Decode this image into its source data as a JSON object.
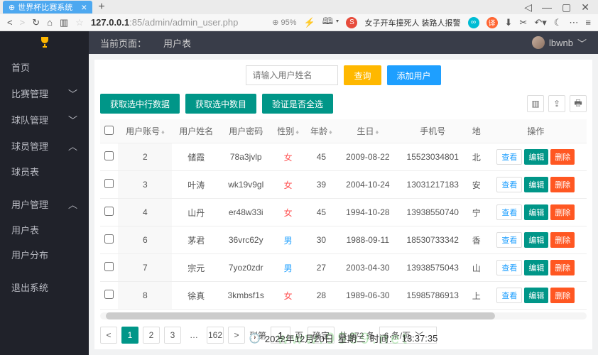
{
  "browser": {
    "tab_title": "世界杯比赛系统",
    "url_prefix": "127.0.0.1",
    "url_rest": ":85/admin/admin_user.php",
    "zoom": "95%",
    "news": "女子开车撞死人 装路人报警",
    "win": {
      "min": "—",
      "max": "▢",
      "close": "✕"
    }
  },
  "topbar": {
    "current_page_label": "当前页面：",
    "current_page": "用户表",
    "username": "lbwnb"
  },
  "sidebar": {
    "home": "首页",
    "match": "比赛管理",
    "team": "球队管理",
    "player": "球员管理",
    "player_list": "球员表",
    "user": "用户管理",
    "user_list": "用户表",
    "user_dist": "用户分布",
    "logout": "退出系统"
  },
  "search": {
    "placeholder": "请输入用户姓名",
    "query_btn": "查询",
    "add_btn": "添加用户"
  },
  "actions": {
    "get_rows": "获取选中行数据",
    "get_count": "获取选中数目",
    "toggle_all": "验证是否全选"
  },
  "table": {
    "headers": {
      "account": "用户账号",
      "name": "用户姓名",
      "password": "用户密码",
      "gender": "性别",
      "age": "年龄",
      "birthday": "生日",
      "phone": "手机号",
      "addr": "地",
      "ops": "操作"
    },
    "ops": {
      "view": "查看",
      "edit": "编辑",
      "delete": "删除"
    },
    "rows": [
      {
        "id": "2",
        "name": "储霞",
        "pwd": "78a3jvlp",
        "gender": "女",
        "age": "45",
        "birthday": "2009-08-22",
        "phone": "15523034801",
        "addr": "北"
      },
      {
        "id": "3",
        "name": "叶涛",
        "pwd": "wk19v9gl",
        "gender": "女",
        "age": "39",
        "birthday": "2004-10-24",
        "phone": "13031217183",
        "addr": "安"
      },
      {
        "id": "4",
        "name": "山丹",
        "pwd": "er48w33i",
        "gender": "女",
        "age": "45",
        "birthday": "1994-10-28",
        "phone": "13938550740",
        "addr": "宁"
      },
      {
        "id": "6",
        "name": "茅君",
        "pwd": "36vrc62y",
        "gender": "男",
        "age": "30",
        "birthday": "1988-09-11",
        "phone": "18530733342",
        "addr": "香"
      },
      {
        "id": "7",
        "name": "宗元",
        "pwd": "7yoz0zdr",
        "gender": "男",
        "age": "27",
        "birthday": "2003-04-30",
        "phone": "13938575043",
        "addr": "山"
      },
      {
        "id": "8",
        "name": "徐真",
        "pwd": "3kmbsf1s",
        "gender": "女",
        "age": "28",
        "birthday": "1989-06-30",
        "phone": "15985786913",
        "addr": "上"
      }
    ]
  },
  "pagination": {
    "pages": [
      "1",
      "2",
      "3",
      "…",
      "162"
    ],
    "goto_label": "到第",
    "page_unit": "页",
    "goto_value": "1",
    "confirm": "确定",
    "total": "共 972 条",
    "per_page": "6 条/页"
  },
  "footer": {
    "date": "2022年12月20日",
    "weekday": "星期二",
    "time_label": "时间：",
    "time": "13:37:35"
  },
  "watermark": "www.9969.net"
}
